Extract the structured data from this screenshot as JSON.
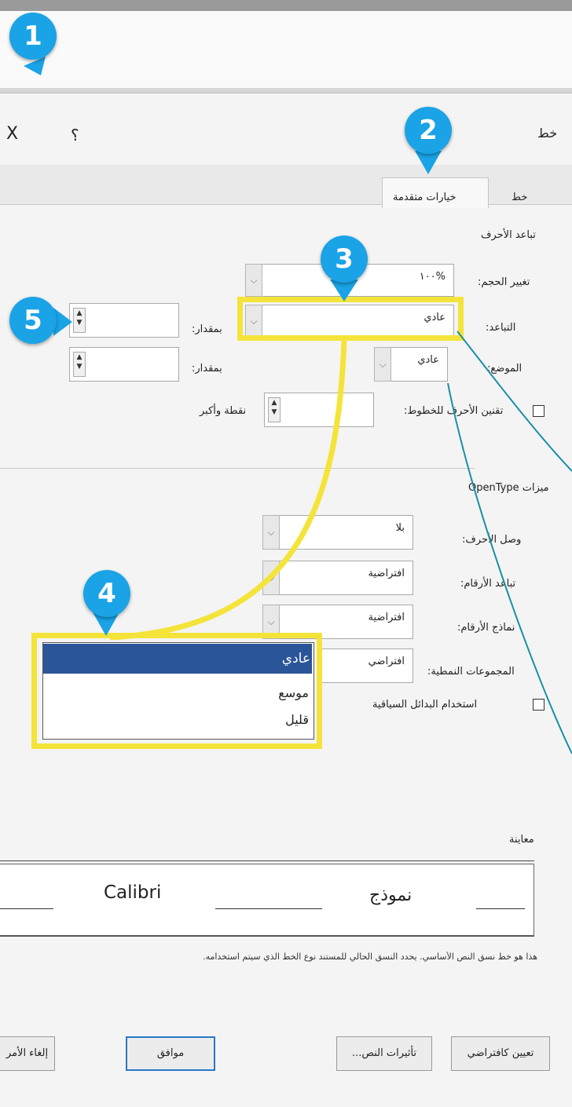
{
  "badges": {
    "b1": "1",
    "b2": "2",
    "b3": "3",
    "b4": "4",
    "b5": "5"
  },
  "dialog": {
    "title": "خط",
    "help": "؟",
    "close": "X"
  },
  "tabs": {
    "font": "خط",
    "advanced": "خيارات متقدمة"
  },
  "spacing": {
    "section": "تباعد الأحرف",
    "scale_label": "تغيير الحجم:",
    "scale_value": "%١٠٠",
    "spacing_label": "التباعد:",
    "spacing_value": "عادي",
    "by1_label": "بمقدار:",
    "position_label": "الموضع:",
    "position_value": "عادي",
    "by2_label": "بمقدار:",
    "kerning_label": "تقنين الأحرف للخطوط:",
    "kerning_suffix": "نقطة وأكبر"
  },
  "opentype": {
    "section": "ميزات OpenType",
    "ligatures_label": "وصل الأحرف:",
    "ligatures_value": "بلا",
    "num_spacing_label": "تباعد الأرقام:",
    "num_spacing_value": "افتراضية",
    "num_forms_label": "نماذج الأرقام:",
    "num_forms_value": "افتراضية",
    "stylistic_label": "المجموعات النمطية:",
    "stylistic_value": "افتراضي",
    "contextual_label": "استخدام البدائل السياقية"
  },
  "dropdown": {
    "options": [
      "عادي",
      "موسع",
      "قليل"
    ]
  },
  "preview": {
    "section": "معاينة",
    "sample_ar": "نموذج",
    "sample_font": "Calibri",
    "description": "هذا هو خط نسق النص الأساسي. يحدد النسق الحالي للمستند نوع الخط الذي سيتم استخدامه."
  },
  "buttons": {
    "default": "تعيين كافتراضي",
    "effects": "تأثيرات النص...",
    "ok": "موافق",
    "cancel": "إلغاء الأمر"
  },
  "colors": {
    "badge": "#1aa3e6",
    "highlight": "#f4e43a",
    "selection": "#2a5599"
  }
}
